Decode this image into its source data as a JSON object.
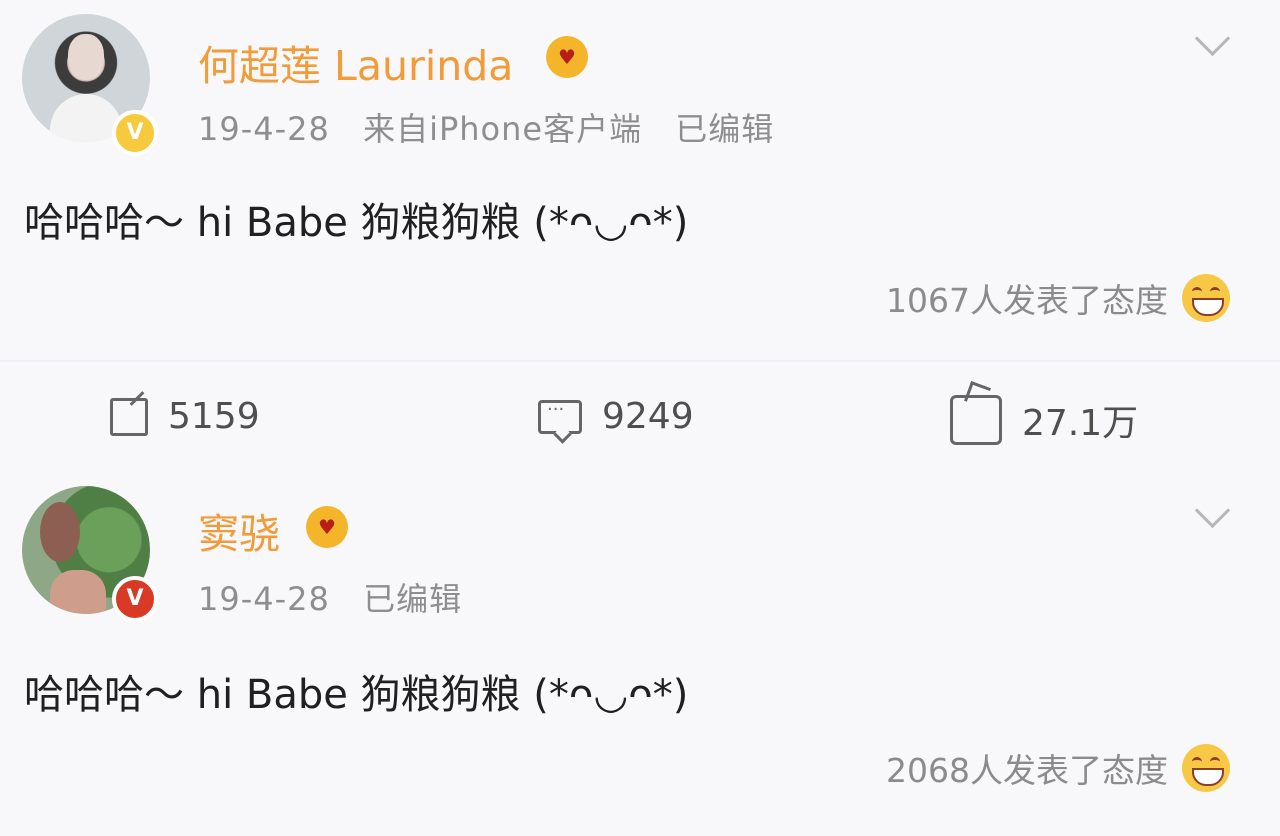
{
  "posts": [
    {
      "user": {
        "name": "何超莲 Laurinda",
        "date": "19-4-28",
        "source": "来自iPhone客户端",
        "edited": "已编辑"
      },
      "content": "哈哈哈～ hi Babe 狗粮狗粮 (*ᴖ◡ᴖ*)",
      "reactions": "1067人发表了态度"
    },
    {
      "user": {
        "name": "窦骁",
        "date": "19-4-28",
        "edited": "已编辑"
      },
      "content": "哈哈哈～ hi Babe 狗粮狗粮 (*ᴖ◡ᴖ*)",
      "reactions": "2068人发表了态度"
    }
  ],
  "actions": {
    "shares": "5159",
    "comments": "9249",
    "likes": "27.1万"
  }
}
